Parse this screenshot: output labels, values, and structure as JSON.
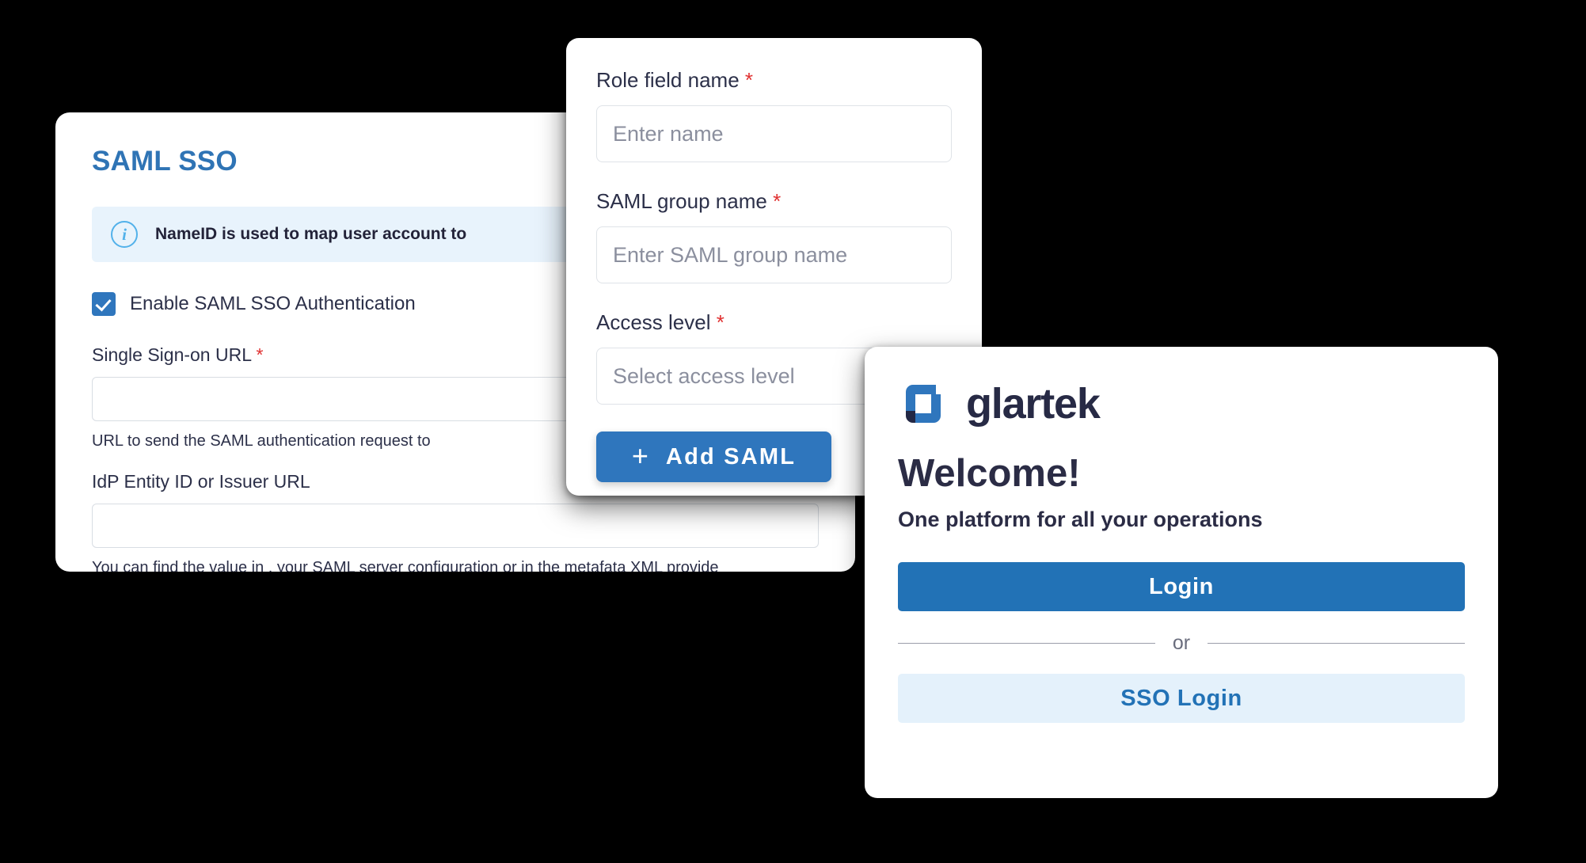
{
  "saml_card": {
    "title": "SAML SSO",
    "info_banner": {
      "icon": "info-circle-icon",
      "text": "NameID is used to map user account to"
    },
    "checkbox": {
      "label": "Enable SAML SSO Authentication",
      "checked": true
    },
    "fields": [
      {
        "label": "Single Sign-on URL",
        "required_marker": "*",
        "value": "",
        "helper": "URL to send the SAML authentication request to"
      },
      {
        "label": "IdP Entity ID or Issuer URL",
        "required_marker": "",
        "value": "",
        "helper": "You can find the value in . your SAML server configuration or in the metafata XML provide"
      }
    ]
  },
  "add_saml_card": {
    "fields": [
      {
        "label": "Role field name",
        "required_marker": "*",
        "placeholder": "Enter name",
        "value": ""
      },
      {
        "label": "SAML group name",
        "required_marker": "*",
        "placeholder": "Enter SAML group name",
        "value": ""
      },
      {
        "label": "Access level",
        "required_marker": "*",
        "placeholder": "Select access level",
        "value": ""
      }
    ],
    "submit_button": {
      "icon": "plus-icon",
      "plus_glyph": "+",
      "label": "Add SAML"
    }
  },
  "login_card": {
    "brand": {
      "logo_icon": "glartek-logo-icon",
      "wordmark": "glartek"
    },
    "heading": "Welcome!",
    "subheading": "One platform for all your operations",
    "primary_button": "Login",
    "divider_text": "or",
    "secondary_button": "SSO Login"
  },
  "colors": {
    "accent_blue": "#2f76bd",
    "title_blue": "#2f74b5",
    "login_blue": "#2272b6",
    "sso_bg": "#e4f1fb",
    "info_bg": "#e8f3fc",
    "info_icon": "#52b1ea",
    "required_red": "#e03030",
    "text_dark": "#2c3049",
    "logo_navy": "#232845",
    "logo_blue": "#2f76bd",
    "page_bg": "#000000"
  }
}
